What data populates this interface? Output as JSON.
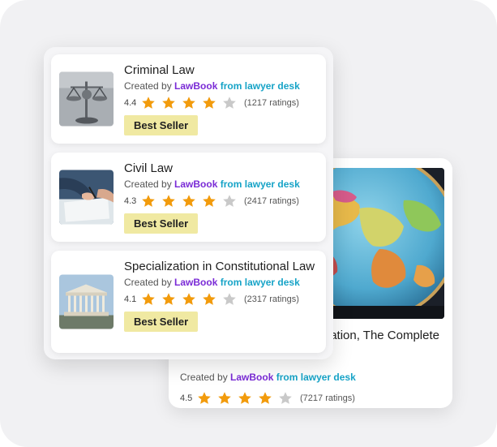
{
  "colors": {
    "star": "#f29b0c",
    "star_empty": "#c9c9c9",
    "badge_bg": "#f0e9a2",
    "brand_law": "#7a2bd6",
    "brand_desk": "#16a3c7"
  },
  "icons": {
    "filled_star": "star-icon",
    "empty_star": "star-outline-icon"
  },
  "courses": [
    {
      "title": "Criminal Law",
      "created_prefix": "Created by",
      "brand_law": "LawBook",
      "brand_desk": "from lawyer desk",
      "rating": "4.4",
      "rating_value": 4.4,
      "ratings_count": "(1217 ratings)",
      "badge": "Best Seller",
      "thumbnail": "scales-of-justice-image"
    },
    {
      "title": "Civil Law",
      "created_prefix": "Created by",
      "brand_law": "LawBook",
      "brand_desk": "from lawyer desk",
      "rating": "4.3",
      "rating_value": 4.3,
      "ratings_count": "(2417 ratings)",
      "badge": "Best Seller",
      "thumbnail": "signing-document-image"
    },
    {
      "title": "Specialization in Constitutional Law",
      "created_prefix": "Created by",
      "brand_law": "LawBook",
      "brand_desk": "from lawyer desk",
      "rating": "4.1",
      "rating_value": 4.1,
      "ratings_count": "(2317 ratings)",
      "badge": "Best Seller",
      "thumbnail": "courthouse-image"
    }
  ],
  "back_course": {
    "title": "ation, The Complete",
    "created_prefix": "Created by",
    "brand_law": "LawBook",
    "brand_desk": "from lawyer desk",
    "rating": "4.5",
    "rating_value": 4.5,
    "ratings_count": "(7217 ratings)",
    "thumbnail": "globe-image"
  }
}
